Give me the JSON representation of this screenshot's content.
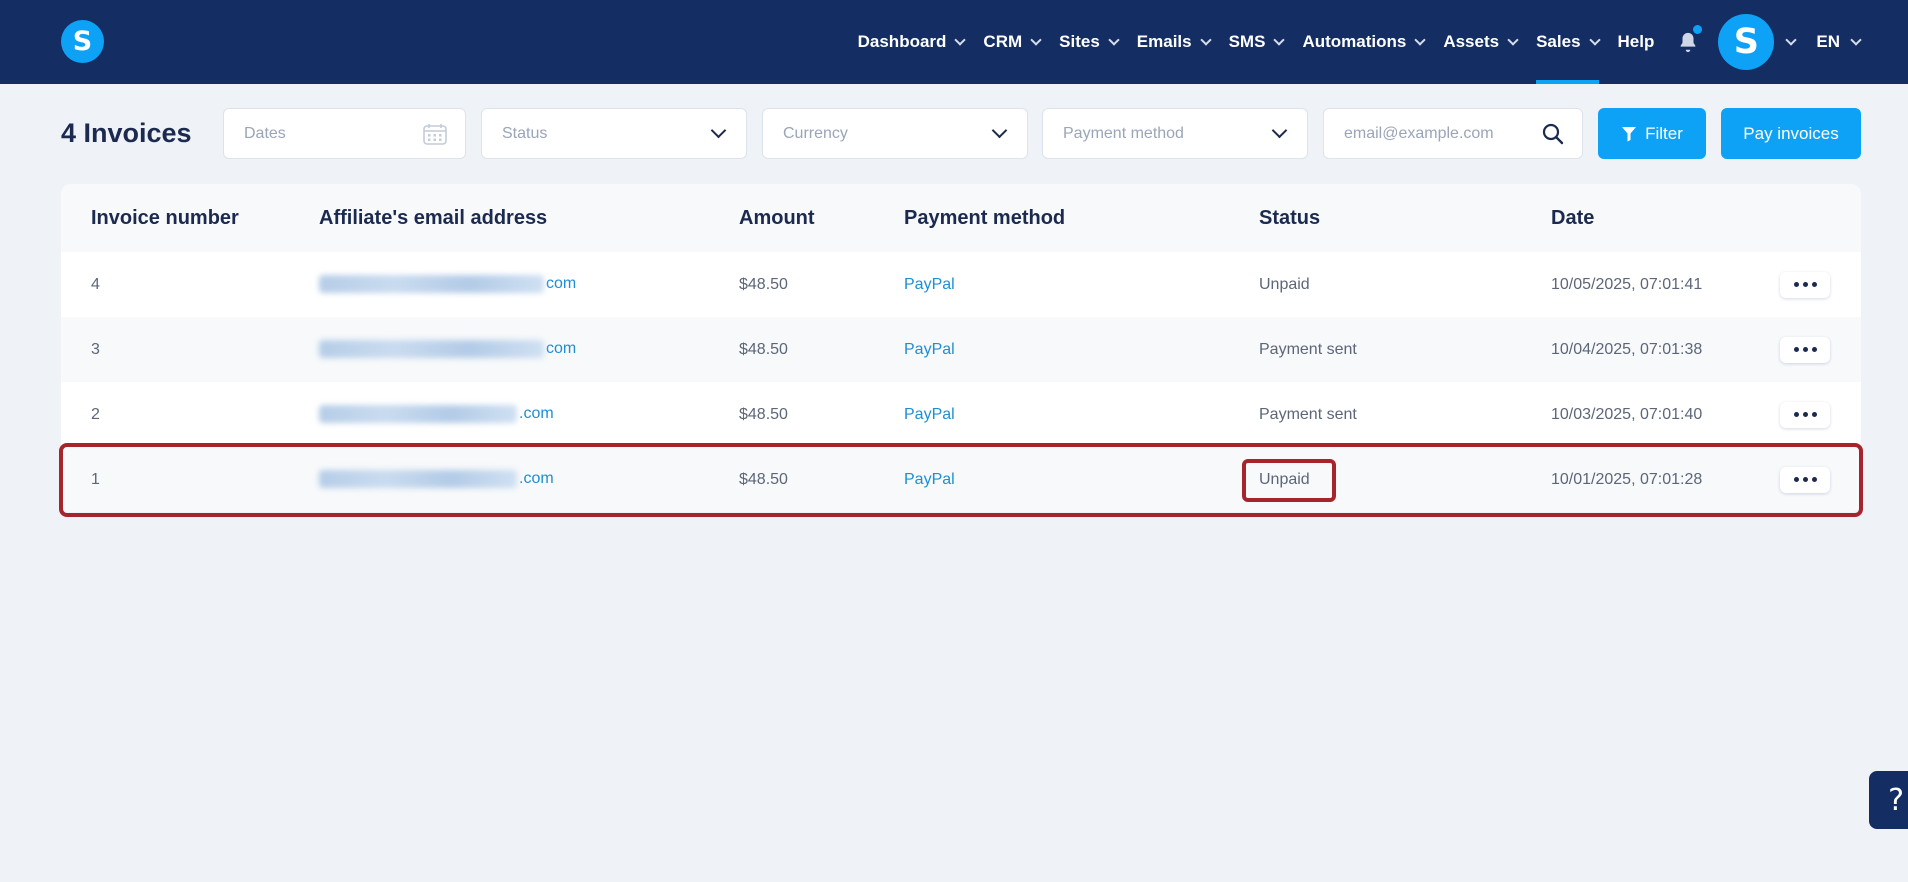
{
  "header": {
    "logo_letter": "S",
    "nav": [
      {
        "label": "Dashboard",
        "has_menu": true,
        "active": false
      },
      {
        "label": "CRM",
        "has_menu": true,
        "active": false
      },
      {
        "label": "Sites",
        "has_menu": true,
        "active": false
      },
      {
        "label": "Emails",
        "has_menu": true,
        "active": false
      },
      {
        "label": "SMS",
        "has_menu": true,
        "active": false
      },
      {
        "label": "Automations",
        "has_menu": true,
        "active": false
      },
      {
        "label": "Assets",
        "has_menu": true,
        "active": false
      },
      {
        "label": "Sales",
        "has_menu": true,
        "active": true
      },
      {
        "label": "Help",
        "has_menu": false,
        "active": false
      }
    ],
    "avatar_letter": "S",
    "language": "EN"
  },
  "toolbar": {
    "title": "4 Invoices",
    "dates_placeholder": "Dates",
    "status_placeholder": "Status",
    "currency_placeholder": "Currency",
    "payment_method_placeholder": "Payment method",
    "email_placeholder": "email@example.com",
    "filter_label": "Filter",
    "pay_label": "Pay invoices"
  },
  "table": {
    "headers": [
      "Invoice number",
      "Affiliate's email address",
      "Amount",
      "Payment method",
      "Status",
      "Date"
    ],
    "rows": [
      {
        "number": "4",
        "email_suffix": "com",
        "amount": "$48.50",
        "method": "PayPal",
        "status": "Unpaid",
        "date": "10/05/2025, 07:01:41"
      },
      {
        "number": "3",
        "email_suffix": "com",
        "amount": "$48.50",
        "method": "PayPal",
        "status": "Payment sent",
        "date": "10/04/2025, 07:01:38"
      },
      {
        "number": "2",
        "email_suffix": ".com",
        "amount": "$48.50",
        "method": "PayPal",
        "status": "Payment sent",
        "date": "10/03/2025, 07:01:40"
      },
      {
        "number": "1",
        "email_suffix": ".com",
        "amount": "$48.50",
        "method": "PayPal",
        "status": "Unpaid",
        "date": "10/01/2025, 07:01:28"
      }
    ]
  },
  "help_button": "?",
  "colors": {
    "topbar": "#142d63",
    "accent": "#0ea2f6",
    "link": "#1e8fd3",
    "highlight": "#a6252c"
  }
}
